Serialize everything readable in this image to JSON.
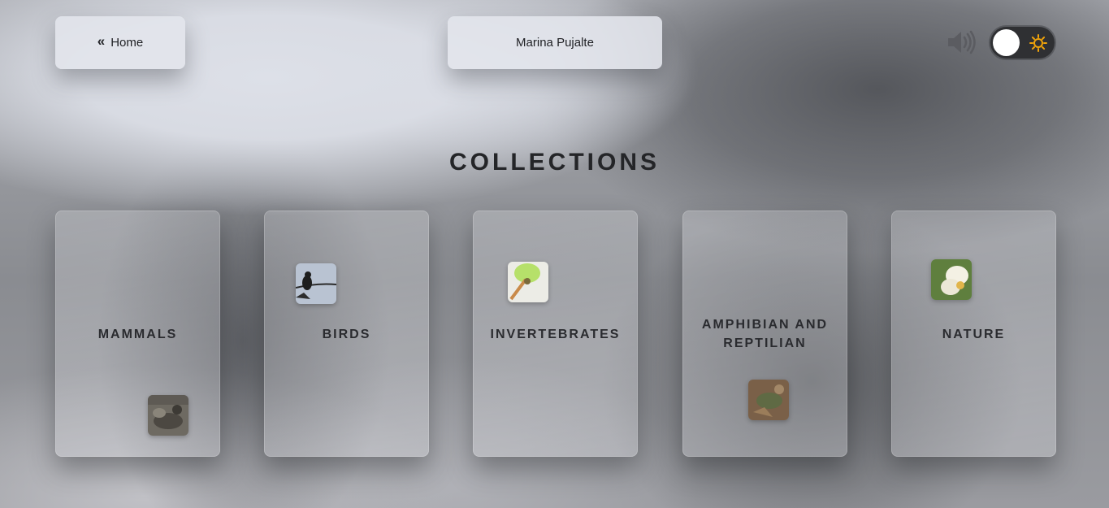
{
  "header": {
    "home_label": "Home",
    "user_name": "Marina Pujalte",
    "sound_icon": "speaker-volume-icon",
    "theme_toggle": {
      "state": "off",
      "icon": "sun-icon",
      "accent": "#f0a30a"
    }
  },
  "main": {
    "title": "COLLECTIONS",
    "collections": [
      {
        "label": "MAMMALS",
        "image": "mammal-photo"
      },
      {
        "label": "BIRDS",
        "image": "bird-photo"
      },
      {
        "label": "INVERTEBRATES",
        "image": "invertebrate-photo"
      },
      {
        "label": "AMPHIBIAN AND REPTILIAN",
        "image": "reptile-photo"
      },
      {
        "label": "NATURE",
        "image": "flower-photo"
      }
    ]
  }
}
